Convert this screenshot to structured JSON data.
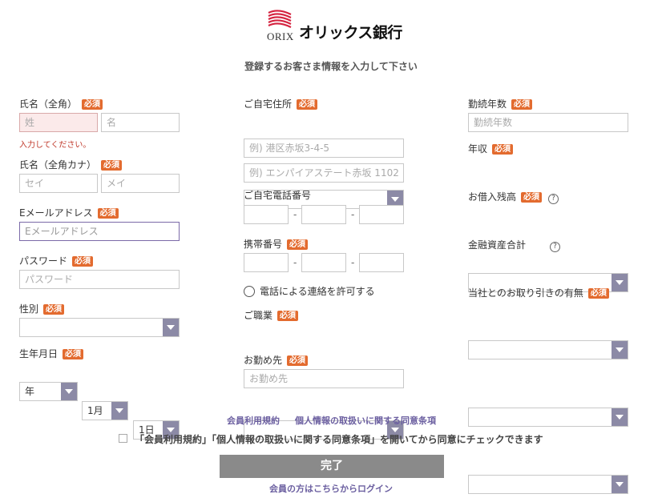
{
  "header": {
    "logo_orix": "ORIX",
    "logo_bank": "オリックス銀行",
    "subtitle": "登録するお客さま情報を入力して下さい"
  },
  "required_badge": "必須",
  "help_glyph": "?",
  "left": {
    "name": {
      "label": "氏名（全角）",
      "last_placeholder": "姓",
      "first_placeholder": "名",
      "error": "入力してください。"
    },
    "kana": {
      "label": "氏名（全角カナ）",
      "last_placeholder": "セイ",
      "first_placeholder": "メイ"
    },
    "email": {
      "label": "Eメールアドレス",
      "placeholder": "Eメールアドレス"
    },
    "password": {
      "label": "パスワード",
      "placeholder": "パスワード"
    },
    "gender": {
      "label": "性別",
      "value": ""
    },
    "birthday": {
      "label": "生年月日",
      "year": "年",
      "month": "1月",
      "day": "1日"
    }
  },
  "middle": {
    "address": {
      "label": "ご自宅住所",
      "prefecture": "",
      "street_placeholder": "例) 港区赤坂3-4-5",
      "building_placeholder": "例) エンパイアステート赤坂 1102"
    },
    "home_phone": {
      "label": "ご自宅電話番号",
      "separator": "-"
    },
    "mobile": {
      "label": "携帯番号",
      "separator": "-"
    },
    "phone_permission": {
      "label": "電話による連絡を許可する"
    },
    "occupation": {
      "label": "ご職業",
      "value": ""
    },
    "employer": {
      "label": "お勤め先",
      "placeholder": "お勤め先"
    }
  },
  "right": {
    "years": {
      "label": "勤続年数",
      "placeholder": "勤続年数"
    },
    "income": {
      "label": "年収",
      "value": ""
    },
    "debt": {
      "label": "お借入残高",
      "value": ""
    },
    "assets": {
      "label": "金融資産合計",
      "value": ""
    },
    "relationship": {
      "label": "当社とのお取り引きの有無",
      "value": ""
    }
  },
  "footer": {
    "terms_link": "会員利用規約",
    "privacy_link": "個人情報の取扱いに関する同意条項",
    "agree_text": "「会員利用規約」「個人情報の取扱いに関する同意条項」を開いてから同意にチェックできます",
    "submit_label": "完了",
    "login_link": "会員の方はこちらからログイン"
  }
}
